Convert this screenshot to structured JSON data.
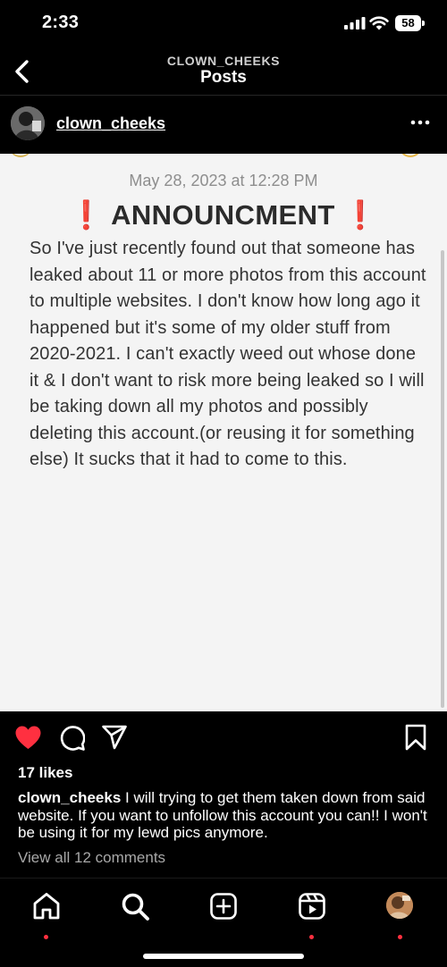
{
  "status_bar": {
    "time": "2:33",
    "battery": "58"
  },
  "header": {
    "username": "CLOWN_CHEEKS",
    "title": "Posts",
    "back_icon": "chevron-left-icon"
  },
  "post": {
    "username": "clown_cheeks",
    "more_icon": "more-horizontal-icon",
    "image": {
      "date": "May 28, 2023 at 12:28 PM",
      "title": "ANNOUNCMENT",
      "title_mark": "❗",
      "body": "So I've just recently found out that someone has leaked about 11 or more photos from this account to multiple websites. I don't know how long ago it happened but it's some of my older stuff from 2020-2021. I can't exactly weed out whose done it & I don't want to risk more being leaked so I will be taking down all my photos and possibly deleting this account.(or reusing it for something else) It sucks that it had to come to this."
    },
    "actions": {
      "liked": true,
      "like_color": "#ff3040"
    },
    "likes": "17 likes",
    "caption": {
      "username": "clown_cheeks",
      "text": "I will trying to get them taken down from said website. If you want to unfollow this account you can!! I won't be using it for my lewd pics anymore."
    },
    "view_comments": "View all 12 comments"
  },
  "tabbar": {
    "items": [
      "home-icon",
      "search-icon",
      "create-icon",
      "reels-icon",
      "profile-avatar"
    ],
    "notification_color": "#ff3040"
  }
}
